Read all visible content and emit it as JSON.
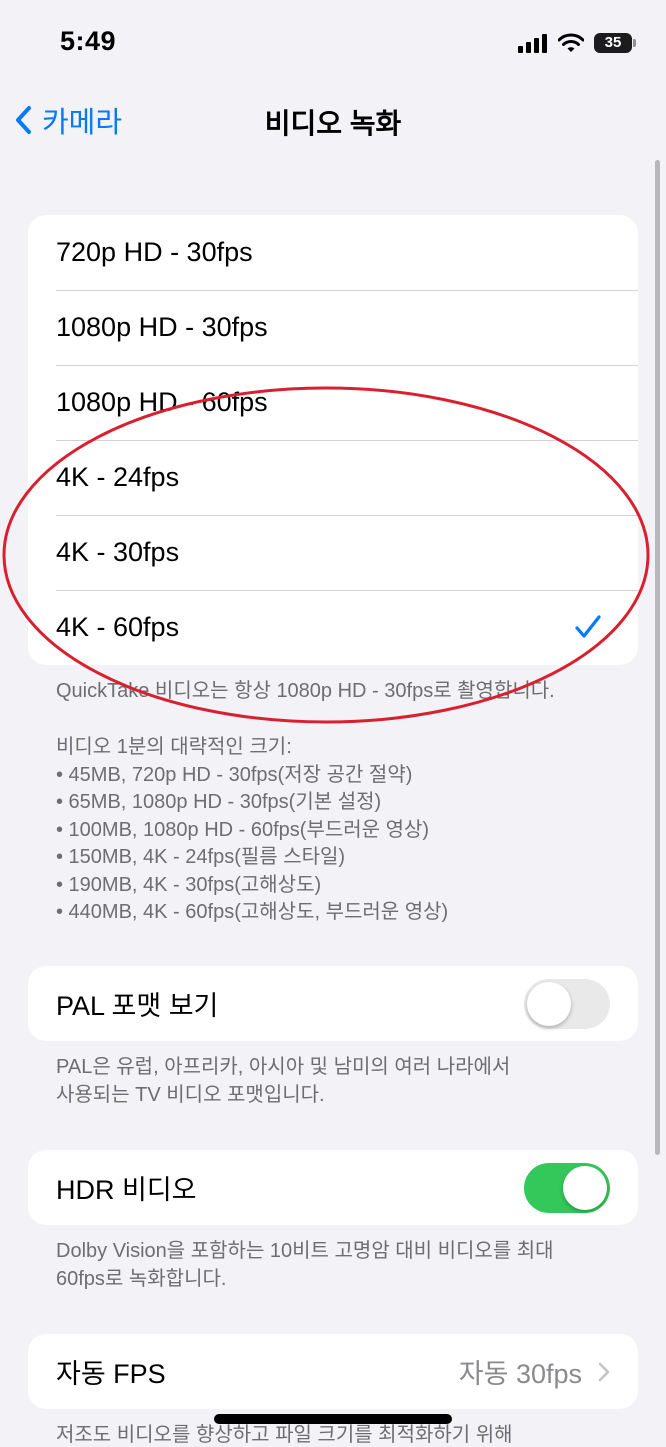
{
  "status_bar": {
    "time": "5:49",
    "battery": "35"
  },
  "nav": {
    "back_label": "카메라",
    "title": "비디오 녹화"
  },
  "video_formats": {
    "options": [
      {
        "label": "720p HD - 30fps",
        "selected": false
      },
      {
        "label": "1080p HD - 30fps",
        "selected": false
      },
      {
        "label": "1080p HD - 60fps",
        "selected": false
      },
      {
        "label": "4K - 24fps",
        "selected": false
      },
      {
        "label": "4K - 30fps",
        "selected": false
      },
      {
        "label": "4K - 60fps",
        "selected": true
      }
    ],
    "quicktake_note": "QuickTake 비디오는 항상 1080p HD - 30fps로 촬영합니다.",
    "size_heading": "비디오 1분의 대략적인 크기:",
    "size_items": [
      "• 45MB, 720p HD - 30fps(저장 공간 절약)",
      "• 65MB, 1080p HD - 30fps(기본 설정)",
      "• 100MB, 1080p HD - 60fps(부드러운 영상)",
      "• 150MB, 4K - 24fps(필름 스타일)",
      "• 190MB, 4K - 30fps(고해상도)",
      "• 440MB, 4K - 60fps(고해상도, 부드러운 영상)"
    ]
  },
  "pal": {
    "label": "PAL 포맷 보기",
    "enabled": false,
    "note_lines": [
      "PAL은 유럽, 아프리카, 아시아 및 남미의 여러 나라에서",
      "사용되는 TV 비디오 포맷입니다."
    ]
  },
  "hdr": {
    "label": "HDR 비디오",
    "enabled": true,
    "note_lines": [
      "Dolby Vision을 포함하는 10비트 고명암 대비 비디오를 최대",
      "60fps로 녹화합니다."
    ]
  },
  "auto_fps": {
    "label": "자동 FPS",
    "value": "자동 30fps",
    "note_partial": "저조도 비디오를 향상하고 파일 크기를 최적화하기 위해"
  },
  "colors": {
    "accent": "#007aff",
    "toggle_on": "#34c759",
    "annotation": "#d9202f",
    "background": "#f2f2f7"
  }
}
